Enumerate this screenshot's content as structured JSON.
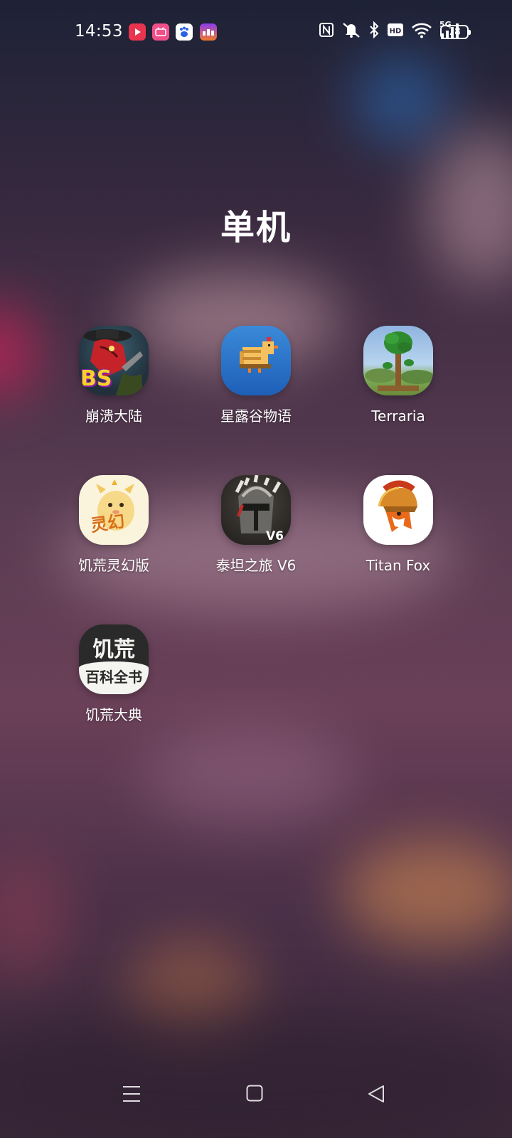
{
  "status_bar": {
    "time": "14:53",
    "notification_icons": [
      "video-app-icon",
      "bilibili-icon",
      "baidu-icon",
      "rank-app-icon"
    ],
    "system_icons": [
      "nfc-icon",
      "mute-icon",
      "bluetooth-icon",
      "hd-icon",
      "wifi-icon",
      "5g-signal-icon"
    ],
    "network": "5G",
    "battery": "78"
  },
  "folder": {
    "title": "单机",
    "apps": [
      {
        "label": "崩溃大陆",
        "icon": "crashlands-icon"
      },
      {
        "label": "星露谷物语",
        "icon": "stardew-valley-icon"
      },
      {
        "label": "Terraria",
        "icon": "terraria-icon"
      },
      {
        "label": "饥荒灵幻版",
        "icon": "dont-starve-spirit-icon"
      },
      {
        "label": "泰坦之旅 V6",
        "icon": "titan-quest-icon"
      },
      {
        "label": "Titan Fox",
        "icon": "titan-fox-icon"
      },
      {
        "label": "饥荒大典",
        "icon": "dont-starve-wiki-icon"
      }
    ],
    "icon_text": {
      "crashlands": "BS",
      "titan_quest_badge": "V6",
      "spirit_badge": "灵幻",
      "wiki_line1": "饥荒",
      "wiki_line2": "百科全书"
    }
  },
  "nav_bar": {
    "buttons": [
      "menu-icon",
      "home-icon",
      "back-icon"
    ]
  }
}
